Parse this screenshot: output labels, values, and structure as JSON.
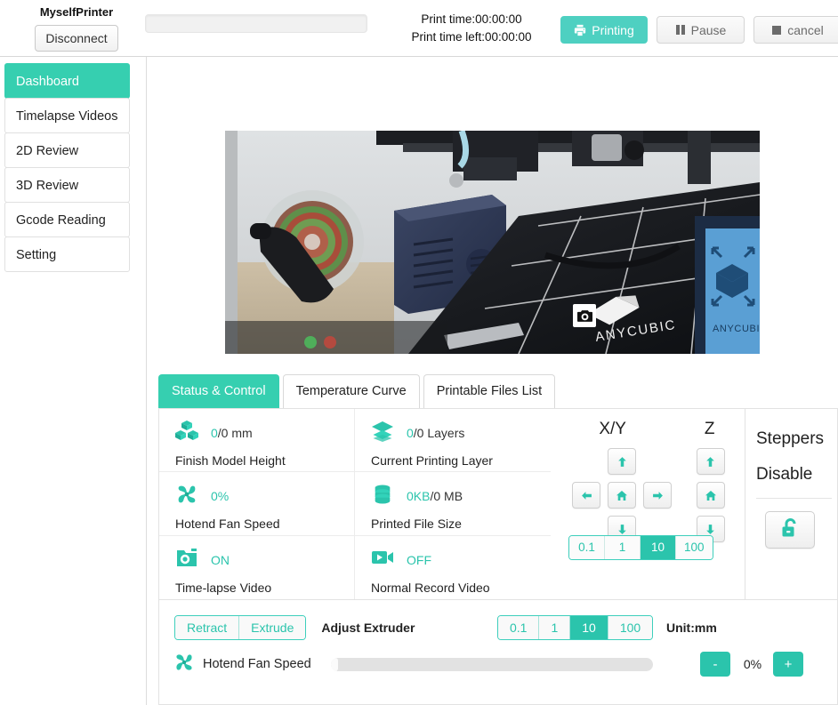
{
  "topbar": {
    "brand_name": "MyselfPrinter",
    "disconnect_label": "Disconnect",
    "progress_percent": 0,
    "print_time_label": "Print time:00:00:00",
    "print_time_left_label": "Print time left:00:00:00",
    "printing_label": "Printing",
    "pause_label": "Pause",
    "cancel_label": "cancel",
    "printing_icon": "printer-icon",
    "pause_icon": "pause-icon",
    "cancel_icon": "stop-square-icon"
  },
  "sidebar": {
    "items": [
      {
        "label": "Dashboard",
        "active": true
      },
      {
        "label": "Timelapse Videos",
        "active": false
      },
      {
        "label": "2D Review",
        "active": false
      },
      {
        "label": "3D Review",
        "active": false
      },
      {
        "label": "Gcode Reading",
        "active": false
      },
      {
        "label": "Setting",
        "active": false
      }
    ]
  },
  "camera": {
    "snapshot_icon": "camera-snapshot-icon",
    "brand_on_bed": "ANYCUBIC",
    "brand_on_screen": "ANYCUBIC"
  },
  "tabs": [
    {
      "label": "Status & Control",
      "active": true
    },
    {
      "label": "Temperature Curve",
      "active": false
    },
    {
      "label": "Printable Files List",
      "active": false
    }
  ],
  "status_cells": [
    {
      "icon": "cubes-icon",
      "value": "0",
      "unit": "/0 mm",
      "label": "Finish Model Height"
    },
    {
      "icon": "layers-icon",
      "value": "0",
      "unit": "/0 Layers",
      "label": "Current Printing Layer"
    },
    {
      "icon": "fan-icon",
      "value": "0%",
      "unit": "",
      "label": "Hotend Fan Speed"
    },
    {
      "icon": "database-icon",
      "value": "0KB",
      "unit": "/0 MB",
      "label": "Printed File Size"
    },
    {
      "icon": "photo-camera-icon",
      "value": "ON",
      "unit": "",
      "label": "Time-lapse Video"
    },
    {
      "icon": "video-camera-icon",
      "value": "OFF",
      "unit": "",
      "label": "Normal Record Video"
    }
  ],
  "jog": {
    "xy_label": "X/Y",
    "z_label": "Z",
    "xy_up_icon": "arrow-up-icon",
    "xy_left_icon": "arrow-left-icon",
    "xy_home_icon": "home-icon",
    "xy_right_icon": "arrow-right-icon",
    "xy_down_icon": "arrow-down-icon",
    "z_up_icon": "arrow-up-icon",
    "z_home_icon": "home-icon",
    "z_down_icon": "arrow-down-icon",
    "steps": [
      {
        "label": "0.1",
        "active": false
      },
      {
        "label": "1",
        "active": false
      },
      {
        "label": "10",
        "active": true
      },
      {
        "label": "100",
        "active": false
      }
    ]
  },
  "steppers": {
    "title_line1": "Steppers",
    "title_line2": "Disable",
    "lock_icon": "unlock-icon"
  },
  "extruder": {
    "retract_label": "Retract",
    "extrude_label": "Extrude",
    "adjust_label": "Adjust Extruder",
    "unit_label": "Unit:mm",
    "steps": [
      {
        "label": "0.1",
        "active": false
      },
      {
        "label": "1",
        "active": false
      },
      {
        "label": "10",
        "active": true
      },
      {
        "label": "100",
        "active": false
      }
    ]
  },
  "fan": {
    "icon": "fan-icon",
    "label": "Hotend Fan Speed",
    "percent_label": "0%",
    "slider_value": 0,
    "minus_label": "-",
    "plus_label": "+"
  },
  "colors": {
    "accent_teal": "#2bc4ac",
    "accent_teal_bright": "#36cfb0",
    "printing_teal": "#4ed0c1"
  }
}
